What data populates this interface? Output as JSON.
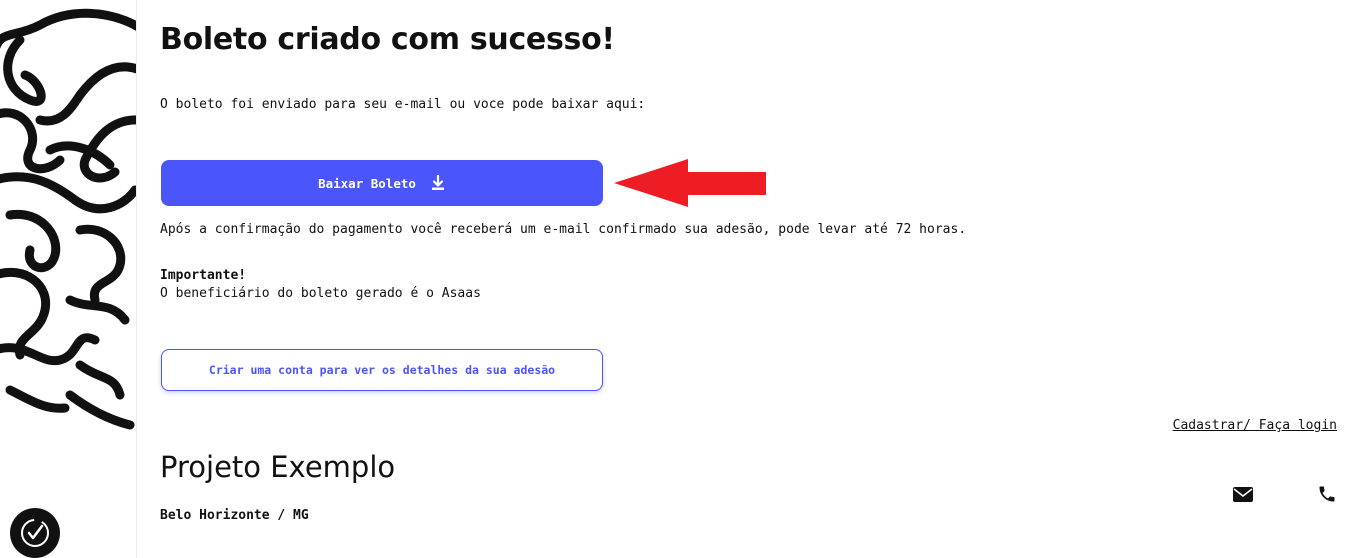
{
  "page": {
    "title": "Boleto criado com sucesso!",
    "subtitle": "O boleto foi enviado para seu e-mail ou voce pode baixar aqui:",
    "download_button": {
      "label": "Baixar Boleto",
      "icon": "download-icon"
    },
    "confirmation_text": "Após a confirmação do pagamento você receberá um e-mail confirmado sua adesão, pode levar até 72 horas.",
    "important": {
      "heading": "Importante!",
      "text": "O beneficiário do boleto gerado é o Asaas"
    },
    "create_account_button": {
      "label": "Criar uma conta para ver os detalhes da sua adesão"
    }
  },
  "footer": {
    "login_link": "Cadastrar/ Faça login",
    "project_name": "Projeto Exemplo",
    "location": "Belo Horizonte / MG",
    "contact_icons": [
      "envelope-icon",
      "phone-icon"
    ]
  },
  "colors": {
    "accent": "#4a55fc",
    "annotation_arrow": "#ee1c25",
    "text": "#111111",
    "background": "#ffffff"
  }
}
